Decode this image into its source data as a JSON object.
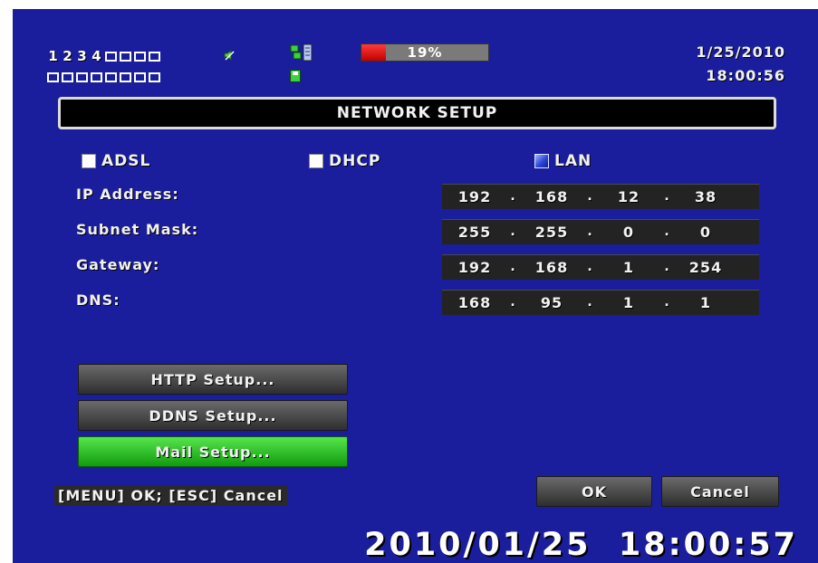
{
  "status": {
    "channels_row1_numbers": [
      "1",
      "2",
      "3",
      "4"
    ],
    "hdd_usage_percent": 19,
    "hdd_usage_label": "19%",
    "date": "1/25/2010",
    "time": "18:00:56"
  },
  "dialog": {
    "title": "NETWORK SETUP",
    "modes": [
      {
        "label": "ADSL",
        "checked": false
      },
      {
        "label": "DHCP",
        "checked": false
      },
      {
        "label": "LAN",
        "checked": true
      }
    ],
    "fields": [
      {
        "label": "IP Address:",
        "octets": [
          "192",
          "168",
          "12",
          "38"
        ]
      },
      {
        "label": "Subnet Mask:",
        "octets": [
          "255",
          "255",
          "0",
          "0"
        ]
      },
      {
        "label": "Gateway:",
        "octets": [
          "192",
          "168",
          "1",
          "254"
        ]
      },
      {
        "label": "DNS:",
        "octets": [
          "168",
          "95",
          "1",
          "1"
        ]
      }
    ],
    "octet_separator": ".",
    "buttons": {
      "http": "HTTP Setup...",
      "ddns": "DDNS Setup...",
      "mail": "Mail Setup...",
      "ok": "OK",
      "cancel": "Cancel"
    },
    "hint": "[MENU] OK; [ESC] Cancel"
  },
  "osd_clock": "2010/01/25  18:00:57",
  "colors": {
    "background": "#1b1e9c",
    "selected_button": "#2ecc2a",
    "hdd_fill": "#e01010"
  },
  "icons": [
    "speaker-icon",
    "network-icon",
    "disk-icon"
  ]
}
